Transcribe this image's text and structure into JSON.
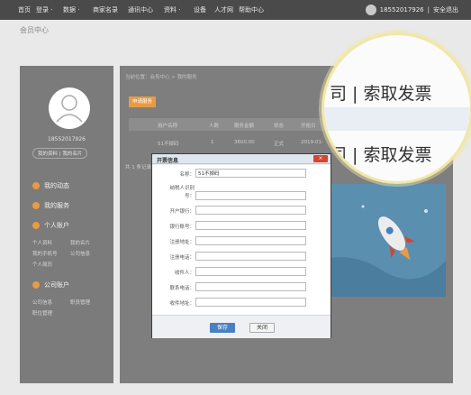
{
  "topbar": {
    "items": [
      "首页",
      "登录 ·",
      "数据 ·",
      "商家名录",
      "通讯中心",
      "资料 ·",
      "设备",
      "人才网",
      "帮助中心"
    ],
    "user_phone": "18552017926",
    "logout": "安全退出"
  },
  "page_title": "会员中心",
  "sidebar": {
    "phone": "18552017926",
    "links": "我的资料 | 我的名片",
    "menu": [
      {
        "label": "我的动态",
        "icon": "activity-icon"
      },
      {
        "label": "我的服务",
        "icon": "service-icon"
      },
      {
        "label": "个人账户",
        "icon": "account-icon"
      },
      {
        "label": "公司账户",
        "icon": "company-icon"
      }
    ],
    "sub_personal": [
      "个人资料",
      "我的名片",
      "我的手机号",
      "公司信息",
      "个人简历"
    ],
    "sub_company": [
      "公司信息",
      "职员管理",
      "职位管理"
    ]
  },
  "main": {
    "breadcrumb": "当前位置：会员中心 > 我的服务",
    "apply_button": "申请服务",
    "table_headers": [
      "用户名称",
      "人数",
      "服务金额",
      "状态",
      "开始日"
    ],
    "table_row": [
      "51不掉码",
      "1",
      "3600.00",
      "正式",
      "2019-01-"
    ],
    "total_label": "共 1 条记录"
  },
  "dialog": {
    "title": "开票信息",
    "close_label": "×",
    "fields": [
      {
        "label": "名称：",
        "value": "51不掉码"
      },
      {
        "label": "纳税人识别号：",
        "value": ""
      },
      {
        "label": "开户银行：",
        "value": ""
      },
      {
        "label": "银行账号：",
        "value": ""
      },
      {
        "label": "注册地址：",
        "value": ""
      },
      {
        "label": "注册电话：",
        "value": ""
      },
      {
        "label": "收件人：",
        "value": ""
      },
      {
        "label": "联系电话：",
        "value": ""
      },
      {
        "label": "收件地址：",
        "value": ""
      }
    ],
    "save_label": "保存",
    "close_button_label": "关闭"
  },
  "magnifier": {
    "top_text": "司 | 索取发票",
    "bottom_text": "司 | 索取发票"
  },
  "colors": {
    "accent": "#e89a45",
    "primary_button": "#4a7fc1",
    "close_red": "#d9432f",
    "overlay_ring": "#f1e7a6"
  }
}
